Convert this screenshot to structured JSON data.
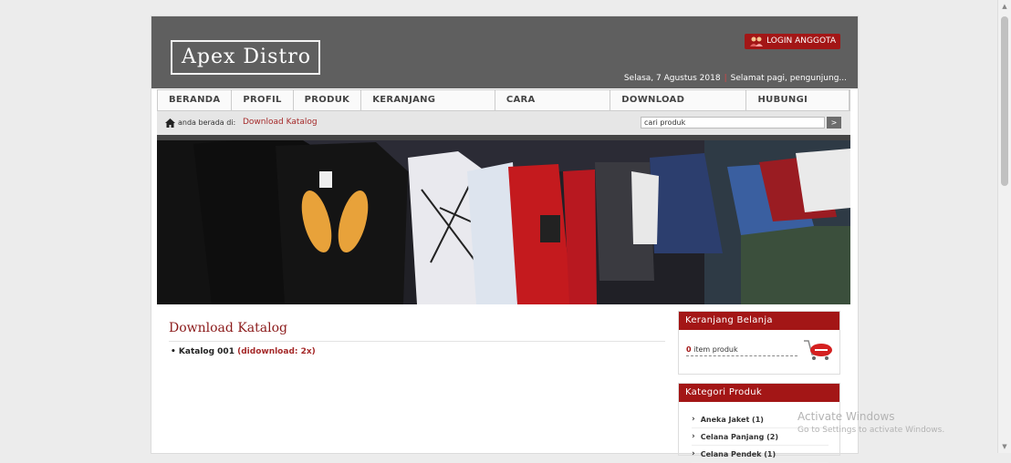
{
  "site": {
    "logo_text": "Apex Distro",
    "login_label": "LOGIN ANGGOTA",
    "date_text": "Selasa, 7 Agustus 2018",
    "greeting_text": "Selamat pagi, pengunjung..."
  },
  "menu": {
    "items": [
      {
        "label": "BERANDA"
      },
      {
        "label": "PROFIL"
      },
      {
        "label": "PRODUK"
      },
      {
        "label": "KERANJANG BELANJA"
      },
      {
        "label": "CARA PEMBELIAN"
      },
      {
        "label": "DOWNLOAD KATALOG"
      },
      {
        "label": "HUBUNGI KAMI"
      }
    ]
  },
  "breadcrumb": {
    "label": "anda berada di:",
    "current": "Download Katalog"
  },
  "search": {
    "value": "cari produk",
    "button": ">"
  },
  "main": {
    "title": "Download Katalog",
    "catalog": {
      "bullet": "•",
      "name": "Katalog 001",
      "count_text": "(didownload: 2x)"
    }
  },
  "cart": {
    "title": "Keranjang Belanja",
    "item_count": "0",
    "item_label": "item produk"
  },
  "categories": {
    "title": "Kategori Produk",
    "items": [
      {
        "label": "Aneka Jaket (1)"
      },
      {
        "label": "Celana Panjang (2)"
      },
      {
        "label": "Celana Pendek (1)"
      }
    ]
  },
  "watermark": {
    "line1": "Activate Windows",
    "line2": "Go to Settings to activate Windows."
  },
  "colors": {
    "header_bg": "#5f5f5f",
    "accent": "#a31616",
    "link": "#a52a2a"
  }
}
